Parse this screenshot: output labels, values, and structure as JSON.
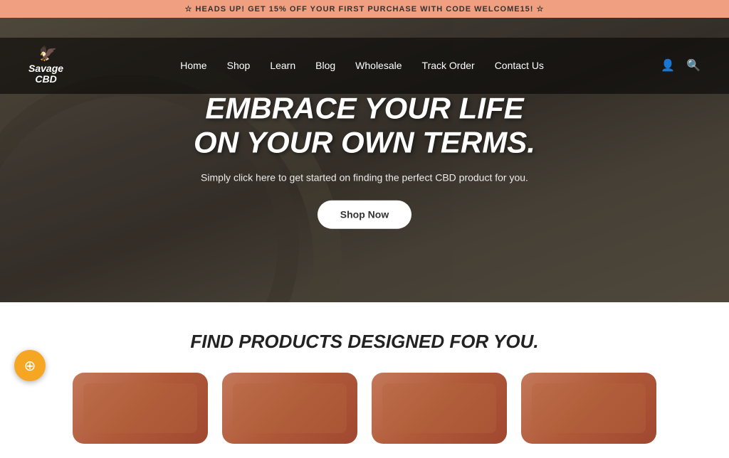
{
  "announcement": {
    "text": "☆  HEADS UP! GET 15% OFF YOUR FIRST PURCHASE WITH CODE WELCOME15!  ☆"
  },
  "header": {
    "logo_line1": "Savage",
    "logo_line2": "CBD",
    "nav_items": [
      {
        "label": "Home",
        "id": "home"
      },
      {
        "label": "Shop",
        "id": "shop"
      },
      {
        "label": "Learn",
        "id": "learn"
      },
      {
        "label": "Blog",
        "id": "blog"
      },
      {
        "label": "Wholesale",
        "id": "wholesale"
      },
      {
        "label": "Track Order",
        "id": "track-order"
      },
      {
        "label": "Contact Us",
        "id": "contact-us"
      }
    ],
    "user_icon": "👤",
    "search_icon": "🔍"
  },
  "hero": {
    "title_line1": "EMBRACE YOUR LIFE",
    "title_line2": "ON YOUR OWN TERMS.",
    "subtitle": "Simply click here to get started on finding the perfect CBD product for you.",
    "cta_label": "Shop Now"
  },
  "products_section": {
    "title": "FIND PRODUCTS DESIGNED FOR YOU.",
    "products": [
      {
        "id": "product-1"
      },
      {
        "id": "product-2"
      },
      {
        "id": "product-3"
      },
      {
        "id": "product-4"
      }
    ]
  },
  "chat": {
    "icon": "⊕"
  }
}
